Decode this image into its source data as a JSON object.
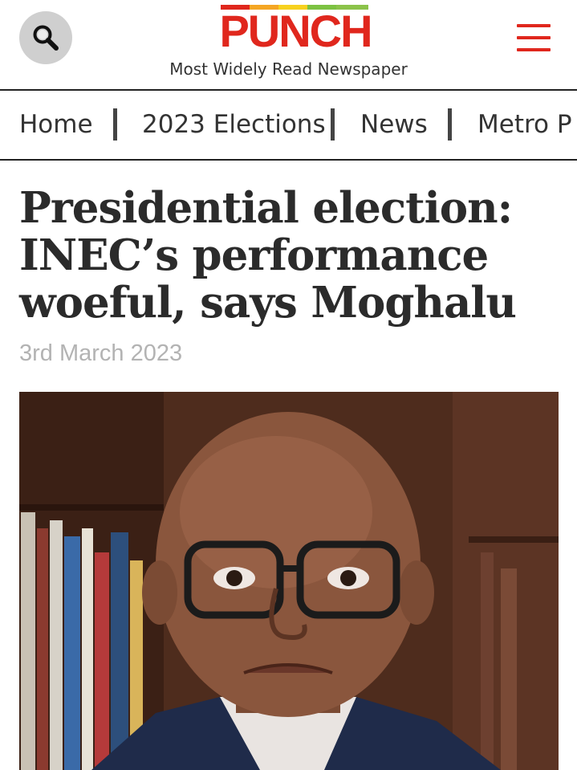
{
  "header": {
    "logo_text": "PUNCH",
    "tagline": "Most Widely Read Newspaper",
    "search_icon": "search-icon",
    "menu_icon": "hamburger-menu-icon",
    "brand_red": "#e0271d"
  },
  "nav": {
    "items": [
      {
        "label": "Home"
      },
      {
        "label": "2023 Elections"
      },
      {
        "label": "News"
      },
      {
        "label": "Metro P"
      }
    ]
  },
  "article": {
    "title": "Presidential election: INEC’s performance woeful, says Moghalu",
    "date": "3rd March 2023",
    "image_description": "portrait-photo"
  }
}
